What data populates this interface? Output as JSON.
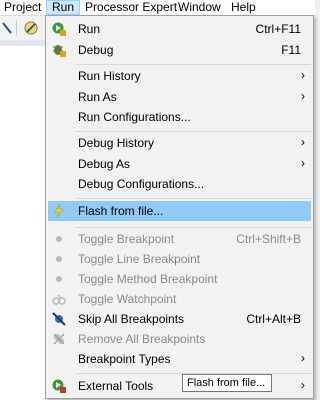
{
  "menubar": {
    "items": [
      "Project",
      "Run",
      "Processor Expert",
      "Window",
      "Help"
    ],
    "active": "Run"
  },
  "menu": {
    "items": [
      {
        "label": "Run",
        "accelerator": "Ctrl+F11",
        "icon": "run-icon"
      },
      {
        "label": "Debug",
        "accelerator": "F11",
        "icon": "debug-icon"
      },
      {
        "label": "Run History",
        "submenu": true
      },
      {
        "label": "Run As",
        "submenu": true
      },
      {
        "label": "Run Configurations..."
      },
      {
        "label": "Debug History",
        "submenu": true
      },
      {
        "label": "Debug As",
        "submenu": true
      },
      {
        "label": "Debug Configurations..."
      },
      {
        "label": "Flash from file...",
        "icon": "flash-icon",
        "highlighted": true
      },
      {
        "label": "Toggle Breakpoint",
        "accelerator": "Ctrl+Shift+B",
        "icon": "breakpoint-icon",
        "disabled": true
      },
      {
        "label": "Toggle Line Breakpoint",
        "icon": "breakpoint-icon",
        "disabled": true
      },
      {
        "label": "Toggle Method Breakpoint",
        "icon": "breakpoint-icon",
        "disabled": true
      },
      {
        "label": "Toggle Watchpoint",
        "icon": "watchpoint-icon",
        "disabled": true
      },
      {
        "label": "Skip All Breakpoints",
        "accelerator": "Ctrl+Alt+B",
        "icon": "skip-breakpoints-icon"
      },
      {
        "label": "Remove All Breakpoints",
        "icon": "remove-breakpoints-icon",
        "disabled": true
      },
      {
        "label": "Breakpoint Types",
        "submenu": true
      },
      {
        "label": "External Tools",
        "submenu": true,
        "icon": "external-tools-icon"
      }
    ]
  },
  "tooltip": "Flash from file..."
}
